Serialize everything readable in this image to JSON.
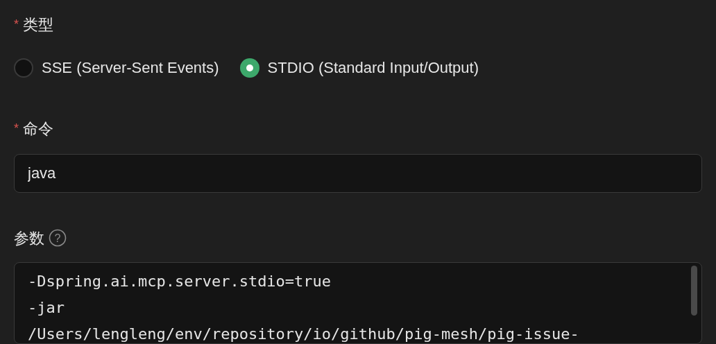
{
  "type_field": {
    "required_mark": "*",
    "label": "类型",
    "options": [
      {
        "label": "SSE (Server-Sent Events)",
        "selected": false
      },
      {
        "label": "STDIO (Standard Input/Output)",
        "selected": true
      }
    ]
  },
  "command_field": {
    "required_mark": "*",
    "label": "命令",
    "value": "java"
  },
  "args_field": {
    "label": "参数",
    "help": "?",
    "lines": [
      "-Dspring.ai.mcp.server.stdio=true",
      "-jar",
      "/Users/lengleng/env/repository/io/github/pig-mesh/pig-issue-"
    ]
  }
}
